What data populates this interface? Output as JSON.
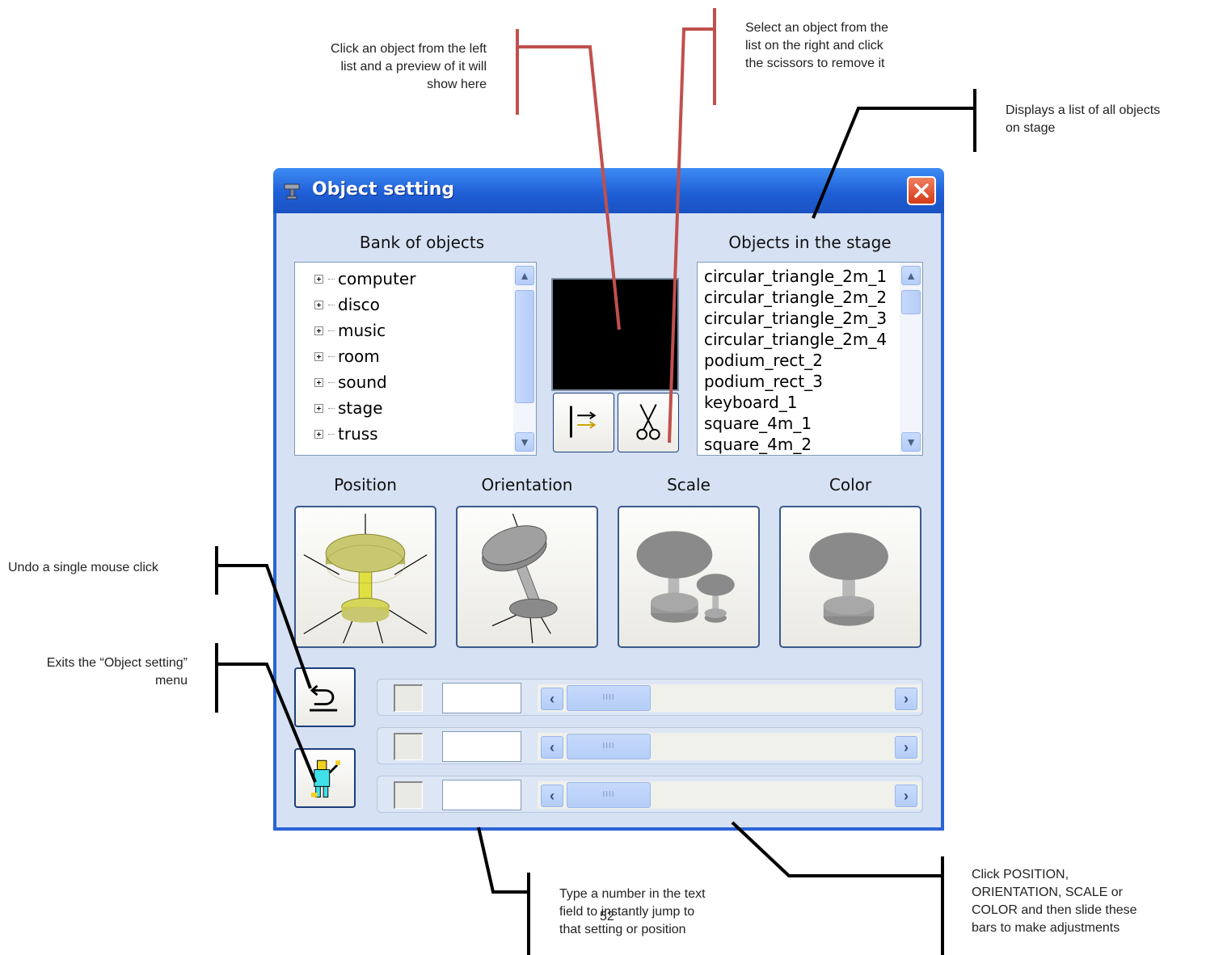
{
  "window": {
    "title": "Object setting",
    "bank_label": "Bank of objects",
    "stage_label": "Objects in the stage",
    "bank_items": [
      "computer",
      "disco",
      "music",
      "room",
      "sound",
      "stage",
      "truss"
    ],
    "stage_items": [
      "circular_triangle_2m_1",
      "circular_triangle_2m_2",
      "circular_triangle_2m_3",
      "circular_triangle_2m_4",
      "podium_rect_2",
      "podium_rect_3",
      "keyboard_1",
      "square_4m_1",
      "square_4m_2"
    ],
    "modes": [
      {
        "label": "Position"
      },
      {
        "label": "Orientation"
      },
      {
        "label": "Scale"
      },
      {
        "label": "Color"
      }
    ]
  },
  "annotations": {
    "preview": "Click an object from the left\nlist and a preview of it will\nshow here",
    "remove": "Select an object from the\nlist on the right and click\nthe scissors to remove it",
    "stage_list": "Displays a list of all objects\non stage",
    "undo": "Undo a single mouse click",
    "exit": "Exits the “Object setting”\nmenu",
    "text_field": "Type a number in the text\nfield to instantly jump to\nthat setting or position",
    "sliders": "Click POSITION,\nORIENTATION, SCALE or\nCOLOR and then slide these\nbars to make adjustments"
  },
  "page_number": "52",
  "colors": {
    "red_callout": "#c0504d",
    "black_callout": "#000000",
    "titlebar": "#2a64d6",
    "client_bg": "#d6e1f3",
    "model_yellow": "#c8c870",
    "model_gray": "#8a8a8a"
  }
}
